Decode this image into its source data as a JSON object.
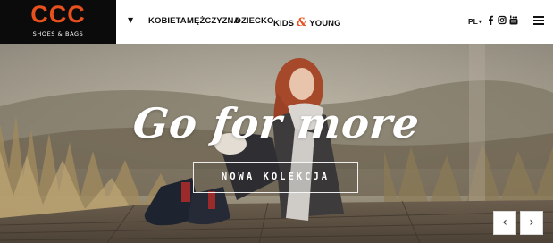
{
  "brand": {
    "logo_text": "CCC",
    "logo_subtext": "SHOES & BAGS",
    "accent_color": "#e8501d"
  },
  "nav": {
    "dropdown_icon": "▼",
    "items": [
      {
        "label": "KOBIETA"
      },
      {
        "label": "MĘŻCZYZNA"
      },
      {
        "label": "DZIECKO"
      },
      {
        "label_part1": "KIDS",
        "label_amp": "&",
        "label_part2": "YOUNG"
      }
    ]
  },
  "header_right": {
    "language": "PL",
    "language_caret": "▾",
    "social_icons": [
      "facebook-icon",
      "instagram-icon",
      "youtube-icon"
    ],
    "menu_icon": "hamburger-menu-icon"
  },
  "hero": {
    "headline": "Go for more",
    "cta_label": "NOWA KOLEKCJA",
    "prev_symbol": "‹",
    "next_symbol": "›"
  }
}
